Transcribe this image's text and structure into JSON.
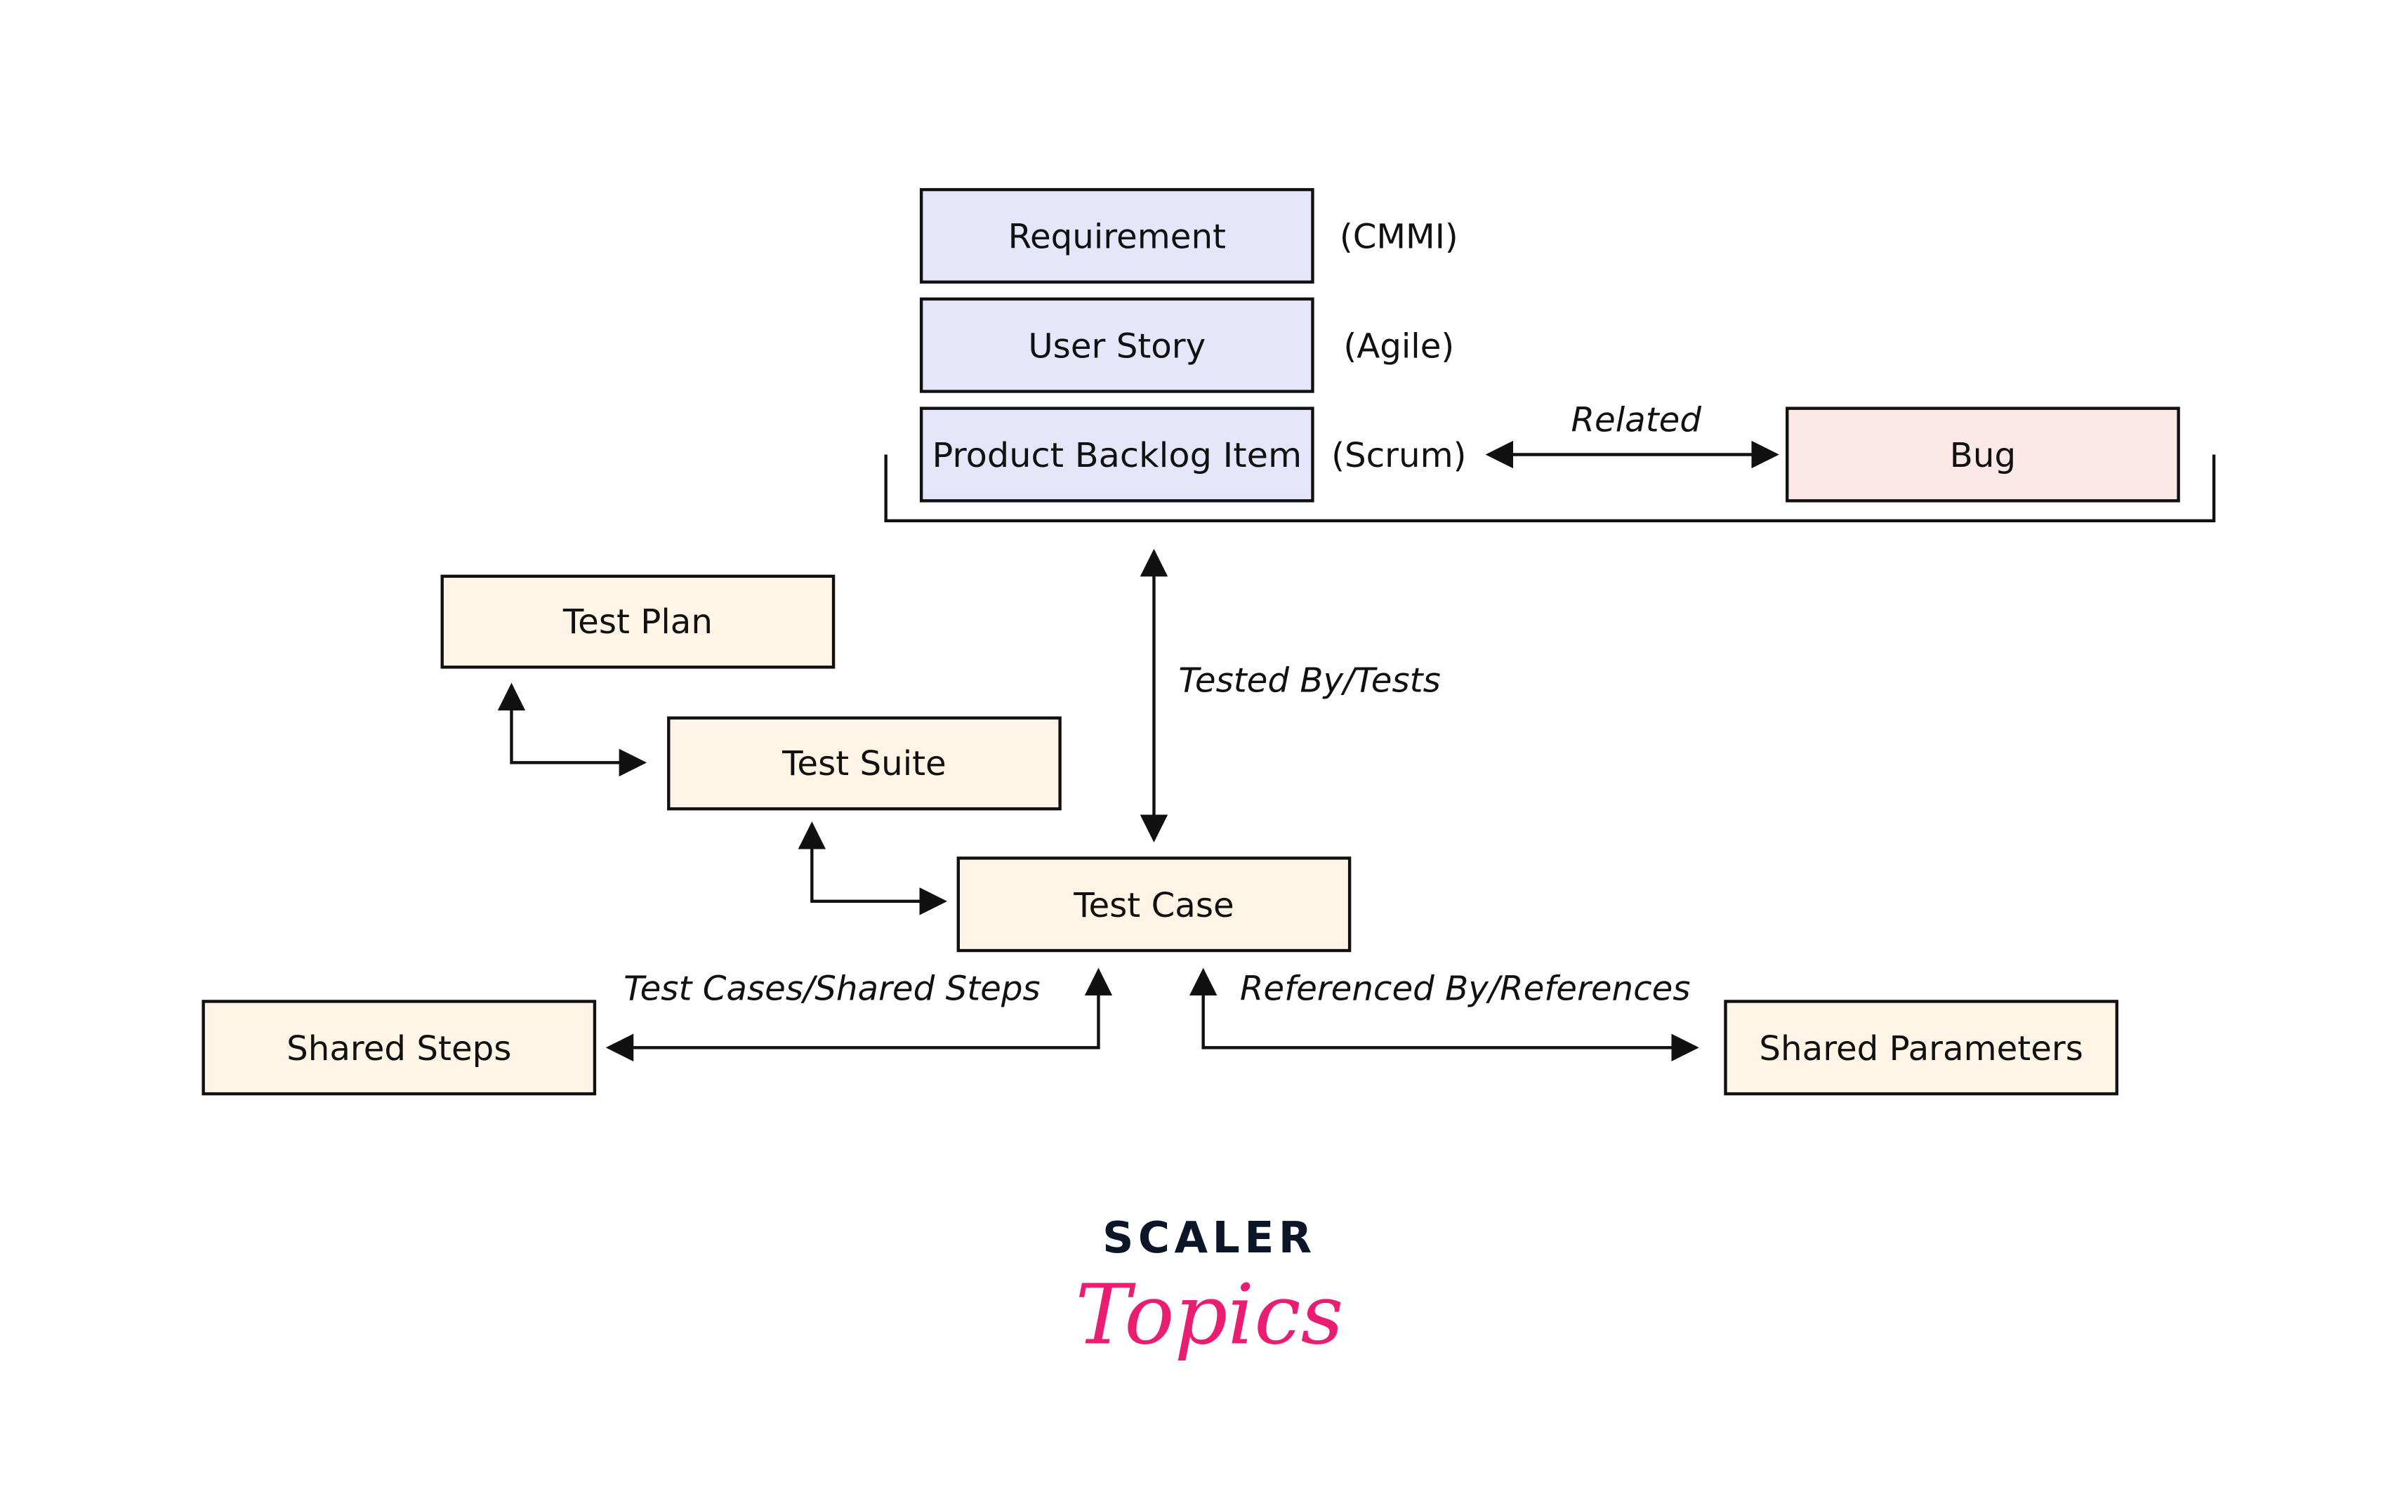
{
  "colors": {
    "work_item_fill": "#e6e6fa",
    "bug_fill": "#fde8e8",
    "test_fill": "#fef5e6",
    "stroke": "#111111",
    "logo_dark": "#0b1629",
    "logo_pink": "#e91e72"
  },
  "nodes": {
    "requirement": "Requirement",
    "user_story": "User Story",
    "pbi": "Product Backlog Item",
    "bug": "Bug",
    "test_plan": "Test Plan",
    "test_suite": "Test Suite",
    "test_case": "Test Case",
    "shared_steps": "Shared Steps",
    "shared_parameters": "Shared Parameters"
  },
  "annotations": {
    "cmmi": "(CMMI)",
    "agile": "(Agile)",
    "scrum": "(Scrum)"
  },
  "edges": {
    "related": "Related",
    "tested_by": "Tested By/Tests",
    "shared_steps": "Test Cases/Shared Steps",
    "referenced_by": "Referenced By/References"
  },
  "logo": {
    "line1": "SCALER",
    "line2": "Topics"
  }
}
